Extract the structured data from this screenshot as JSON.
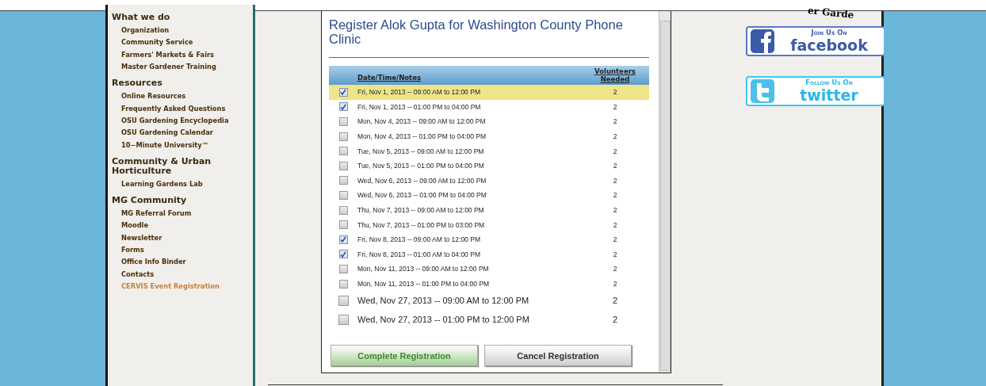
{
  "sidebar": {
    "sections": [
      {
        "heading": "What we do",
        "items": [
          "Organization",
          "Community Service",
          "Farmers' Markets & Fairs",
          "Master Gardener Training"
        ]
      },
      {
        "heading": "Resources",
        "items": [
          "Online Resources",
          "Frequently Asked Questions",
          "OSU Gardening Encyclopedia",
          "OSU Gardening Calendar",
          "10−Minute University™"
        ]
      },
      {
        "heading": "Community & Urban Horticulture",
        "items": [
          "Learning Gardens Lab"
        ]
      },
      {
        "heading": "MG Community",
        "items": [
          "MG Referral Forum",
          "Moodle",
          "Newsletter",
          "Forms",
          "Office Info Binder",
          "Contacts",
          "CERVIS Event Registration"
        ]
      }
    ]
  },
  "dialog": {
    "title": "Register Alok Gupta for Washington County Phone Clinic",
    "columns": [
      "Date/Time/Notes",
      "Volunteers Needed"
    ],
    "rows": [
      {
        "slot": "Fri, Nov 1, 2013 -- 09:00 AM to 12:00 PM",
        "needed": "2",
        "checked": true,
        "selected": true
      },
      {
        "slot": "Fri, Nov 1, 2013 -- 01:00 PM to 04:00 PM",
        "needed": "2",
        "checked": true,
        "selected": false
      },
      {
        "slot": "Mon, Nov 4, 2013 -- 09:00 AM to 12:00 PM",
        "needed": "2",
        "checked": false,
        "selected": false
      },
      {
        "slot": "Mon, Nov 4, 2013 -- 01:00 PM to 04:00 PM",
        "needed": "2",
        "checked": false,
        "selected": false
      },
      {
        "slot": "Tue, Nov 5, 2013 -- 09:00 AM to 12:00 PM",
        "needed": "2",
        "checked": false,
        "selected": false
      },
      {
        "slot": "Tue, Nov 5, 2013 -- 01:00 PM to 04:00 PM",
        "needed": "2",
        "checked": false,
        "selected": false
      },
      {
        "slot": "Wed, Nov 6, 2013 -- 09:00 AM to 12:00 PM",
        "needed": "2",
        "checked": false,
        "selected": false
      },
      {
        "slot": "Wed, Nov 6, 2013 -- 01:00 PM to 04:00 PM",
        "needed": "2",
        "checked": false,
        "selected": false
      },
      {
        "slot": "Thu, Nov 7, 2013 -- 09:00 AM to 12:00 PM",
        "needed": "2",
        "checked": false,
        "selected": false
      },
      {
        "slot": "Thu, Nov 7, 2013 -- 01:00 PM to 03:00 PM",
        "needed": "2",
        "checked": false,
        "selected": false
      },
      {
        "slot": "Fri, Nov 8, 2013 -- 09:00 AM to 12:00 PM",
        "needed": "2",
        "checked": true,
        "selected": false
      },
      {
        "slot": "Fri, Nov 8, 2013 -- 01:00 AM to 04:00 PM",
        "needed": "2",
        "checked": true,
        "selected": false
      },
      {
        "slot": "Mon, Nov 11, 2013 -- 09:00 AM to 12:00 PM",
        "needed": "2",
        "checked": false,
        "selected": false
      },
      {
        "slot": "Mon, Nov 11, 2013 -- 01:00 PM to 04:00 PM",
        "needed": "2",
        "checked": false,
        "selected": false
      },
      {
        "slot": "Wed, Nov 27, 2013 -- 09:00 AM to 12:00 PM",
        "needed": "2",
        "checked": false,
        "selected": false,
        "kind": "large"
      },
      {
        "slot": "Wed, Nov 27, 2013 -- 01:00 PM to 12:00 PM",
        "needed": "2",
        "checked": false,
        "selected": false,
        "kind": "large"
      }
    ],
    "buttons": [
      {
        "label": "Complete Registration",
        "kind": "primary"
      },
      {
        "label": "Cancel Registration",
        "kind": "secondary"
      }
    ]
  },
  "logo_fragment": "er Garde",
  "social": [
    {
      "kind": "facebook",
      "caption": "Join Us On",
      "name": "facebook"
    },
    {
      "kind": "twitter",
      "caption": "Follow Us On",
      "name": "twitter"
    }
  ]
}
